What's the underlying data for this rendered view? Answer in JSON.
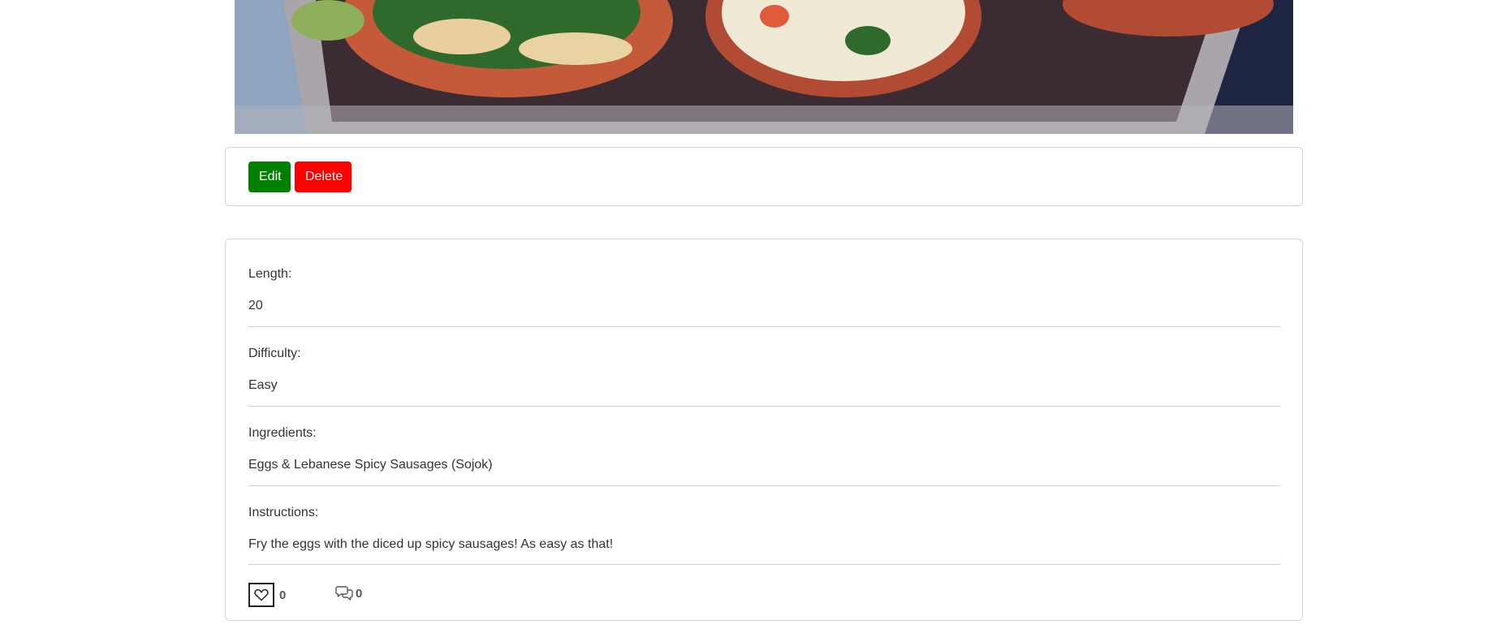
{
  "actions": {
    "edit_label": "Edit",
    "delete_label": "Delete"
  },
  "details": {
    "length_label": "Length:",
    "length_value": "20",
    "difficulty_label": "Difficulty:",
    "difficulty_value": "Easy",
    "ingredients_label": "Ingredients:",
    "ingredients_value": "Eggs & Lebanese Spicy Sausages (Sojok)",
    "instructions_label": "Instructions:",
    "instructions_value": "Fry the eggs with the diced up spicy sausages! As easy as that!"
  },
  "stats": {
    "likes": "0",
    "comments": "0"
  },
  "icons": {
    "like": "heart-icon",
    "comment": "comments-icon"
  },
  "colors": {
    "edit": "#008000",
    "delete": "#ff0000"
  }
}
